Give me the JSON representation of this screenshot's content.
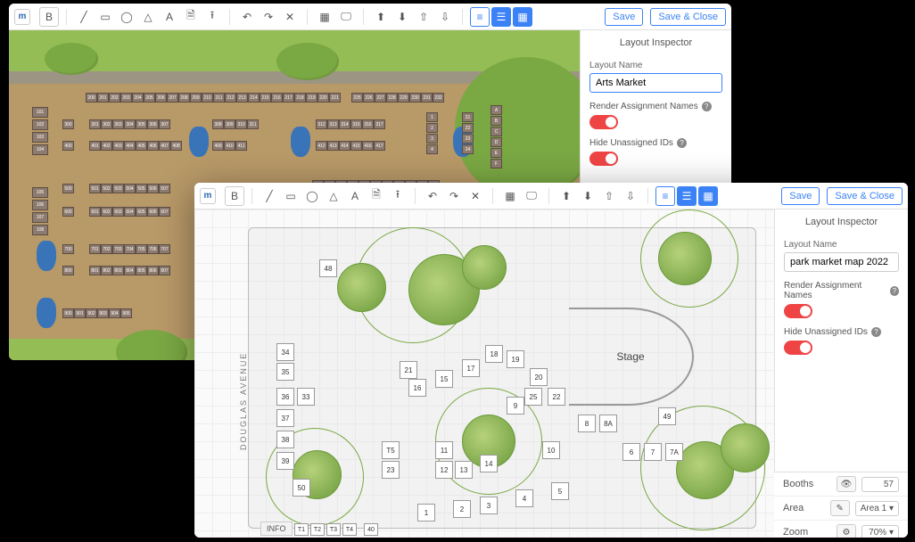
{
  "toolbar": {
    "logo": "m",
    "b_button": "B",
    "save": "Save",
    "save_close": "Save & Close"
  },
  "inspector": {
    "title": "Layout Inspector",
    "layout_name_label": "Layout Name",
    "render_label": "Render Assignment Names",
    "hide_label": "Hide Unassigned IDs"
  },
  "win1": {
    "layout_name": "Arts Market",
    "render_on": true,
    "hide_on": true
  },
  "win2": {
    "layout_name": "park market map 2022",
    "render_on": true,
    "hide_on": true,
    "stage_label": "Stage",
    "street": "DOUGLAS AVENUE",
    "info": "INFO",
    "bottom": {
      "booths_label": "Booths",
      "booths_count": "57",
      "area_label": "Area",
      "area_value": "Area 1",
      "zoom_label": "Zoom",
      "zoom_value": "70%"
    },
    "cells": [
      "48",
      "34",
      "35",
      "36",
      "33",
      "37",
      "38",
      "39",
      "50",
      "T1",
      "T2",
      "T3",
      "T4",
      "40",
      "T5",
      "23",
      "13",
      "12",
      "11",
      "14",
      "10",
      "9",
      "25",
      "21",
      "16",
      "15",
      "17",
      "18",
      "19",
      "20",
      "22",
      "8",
      "8A",
      "49",
      "6",
      "7",
      "7A",
      "1",
      "2",
      "3",
      "4",
      "5"
    ]
  }
}
